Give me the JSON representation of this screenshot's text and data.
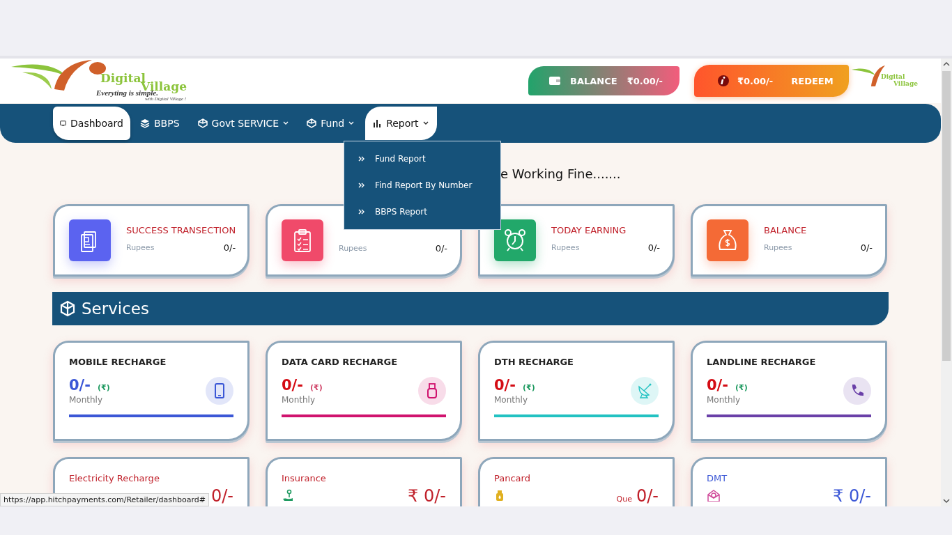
{
  "logo": {
    "line1": "Digital",
    "line2": "Village",
    "tagline": "Everyting is simple.",
    "subline": "with Digital Village !"
  },
  "wallet": {
    "balance_label": "BALANCE",
    "balance_value": "₹0.00/-",
    "reward_value": "₹0.00/-",
    "redeem_label": "REDEEM"
  },
  "small_logo": {
    "line1": "Digital",
    "line2": "Village"
  },
  "nav": [
    {
      "label": "Dashboard",
      "selected": true,
      "dropdown": false,
      "expanded": false
    },
    {
      "label": "BBPS",
      "selected": false,
      "dropdown": false,
      "expanded": false
    },
    {
      "label": "Govt SERVICE",
      "selected": false,
      "dropdown": true,
      "expanded": false
    },
    {
      "label": "Fund",
      "selected": false,
      "dropdown": true,
      "expanded": false
    },
    {
      "label": "Report",
      "selected": false,
      "dropdown": true,
      "expanded": true
    }
  ],
  "report_menu": [
    "Fund Report",
    "Find Report By Number",
    "BBPS Report"
  ],
  "notice": "e Working Fine.......",
  "stats": [
    {
      "title": "SUCCESS TRANSECTION",
      "unit": "Rupees",
      "value": "0/-",
      "color": "#5b63f0"
    },
    {
      "unit": "Rupees",
      "value": "0/-",
      "color": "#f04a6a"
    },
    {
      "title": "TODAY EARNING",
      "unit": "Rupees",
      "value": "0/-",
      "color": "#22a86a"
    },
    {
      "title": "BALANCE",
      "unit": "Rupees",
      "value": "0/-",
      "color": "#f46a36"
    }
  ],
  "services_title": "Services",
  "services": [
    {
      "title": "MOBILE RECHARGE",
      "amount": {
        "text": "0/-",
        "color": "#3b57d6"
      },
      "currency": {
        "text": "(₹)",
        "color": "#1e9a60"
      },
      "period": "Monthly",
      "color": "#3b57d6"
    },
    {
      "title": "DATA CARD RECHARGE",
      "amount": {
        "text": "0/-",
        "color": "#d40c14"
      },
      "currency": {
        "text": "(₹)",
        "color": "#d04468"
      },
      "period": "Monthly",
      "color": "#d0136e"
    },
    {
      "title": "DTH RECHARGE",
      "amount": {
        "text": "0/-",
        "color": "#d40c14"
      },
      "currency": {
        "text": "(₹)",
        "color": "#1e9a60"
      },
      "period": "Monthly",
      "color": "#22c2c2"
    },
    {
      "title": "LANDLINE RECHARGE",
      "amount": {
        "text": "0/-",
        "color": "#d40c14"
      },
      "currency": {
        "text": "(₹)",
        "color": "#1e9a60"
      },
      "period": "Monthly",
      "color": "#6a40a8"
    }
  ],
  "more_services": [
    {
      "title": "Electricity Recharge",
      "color": "#c0202a",
      "amount": "0/-"
    },
    {
      "title": "Insurance",
      "color": "#c0202a",
      "amount": "₹ 0/-"
    },
    {
      "title": "Pancard",
      "color": "#c0202a",
      "prefix": "Que",
      "amount": "0/-"
    },
    {
      "title": "DMT",
      "color": "#3b57d6",
      "amount": "₹ 0/-"
    }
  ],
  "status_url": "https://app.hitchpayments.com/Retailer/dashboard#"
}
